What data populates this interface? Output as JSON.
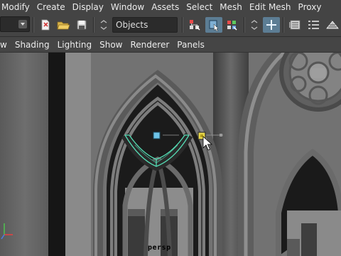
{
  "menubar": {
    "items": [
      "Modify",
      "Create",
      "Display",
      "Window",
      "Assets",
      "Select",
      "Mesh",
      "Edit Mesh",
      "Proxy"
    ]
  },
  "toolbar": {
    "selection_mode_field": "Objects",
    "icons": [
      "dropdown-menu",
      "new-scene",
      "open-folder",
      "save-disk",
      "selection-mask-menu",
      "select-by-hierarchy",
      "select-by-object",
      "select-by-component",
      "snap-menu",
      "snap-to-grid",
      "history",
      "render-settings",
      "attribute-editor",
      "channel-box"
    ],
    "accent": "#5c7d94"
  },
  "panel_menu": {
    "items": [
      "w",
      "Shading",
      "Lighting",
      "Show",
      "Renderer",
      "Panels"
    ]
  },
  "viewport": {
    "camera_label": "persp",
    "selection_color": "#55dcb4",
    "manipulator_color": "#e8d84a"
  }
}
